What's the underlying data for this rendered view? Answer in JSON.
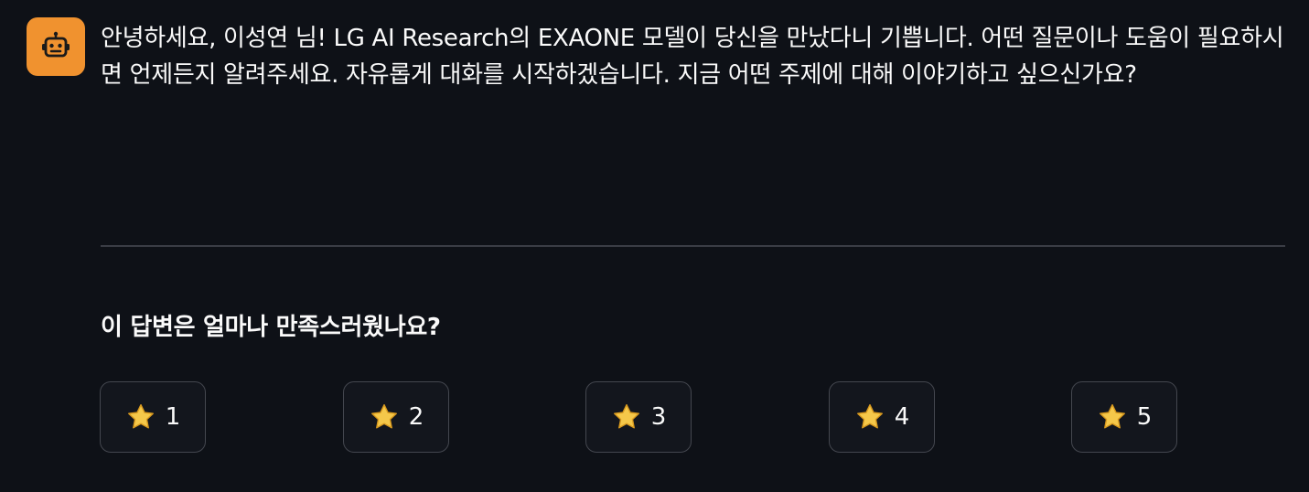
{
  "chat": {
    "assistant_avatar_icon": "robot-icon",
    "avatar_color": "#f0922f",
    "message_text": "안녕하세요, 이성연 님! LG AI Research의 EXAONE 모델이 당신을 만났다니 기쁩니다. 어떤 질문이나 도움이 필요하시면 언제든지 알려주세요. 자유롭게 대화를 시작하겠습니다. 지금 어떤 주제에 대해 이야기하고 싶으신가요?"
  },
  "feedback": {
    "question": "이 답변은 얼마나 만족스러웠나요?",
    "star_icon": "star-icon",
    "star_color": "#f5c84a",
    "ratings": [
      {
        "label": "1"
      },
      {
        "label": "2"
      },
      {
        "label": "3"
      },
      {
        "label": "4"
      },
      {
        "label": "5"
      }
    ]
  },
  "colors": {
    "background": "#0e1117",
    "text": "#fafafa",
    "button_border": "#44474f",
    "divider": "#3a3d45"
  }
}
